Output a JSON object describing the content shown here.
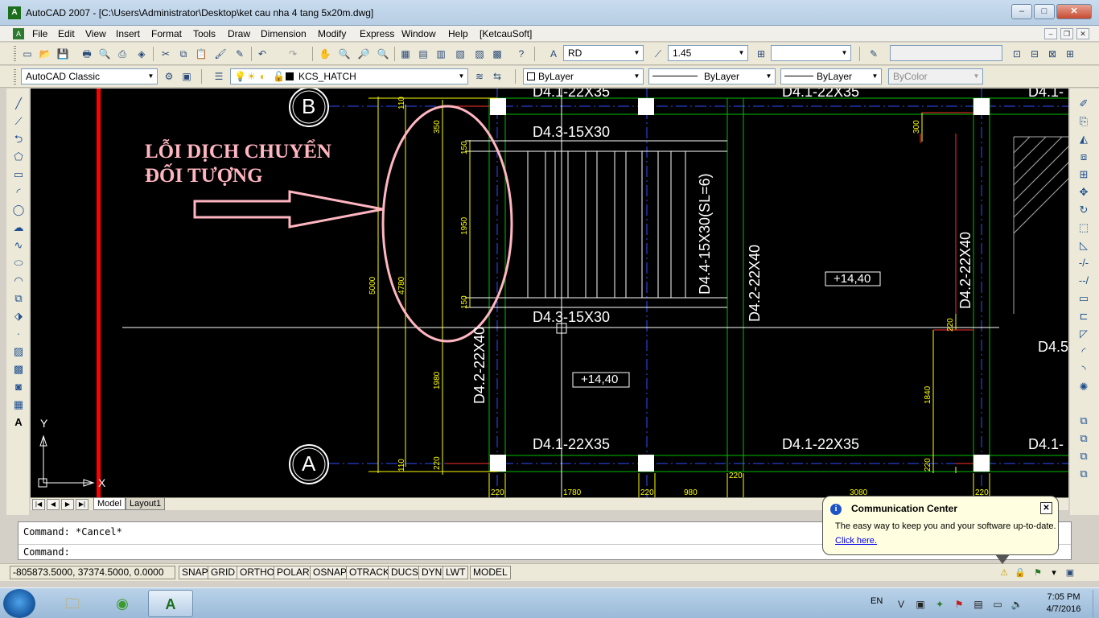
{
  "window": {
    "title": "AutoCAD 2007 - [C:\\Users\\Administrator\\Desktop\\ket cau nha 4 tang 5x20m.dwg]",
    "controls": [
      "–",
      "□",
      "✕"
    ]
  },
  "menubar": {
    "items": [
      "File",
      "Edit",
      "View",
      "Insert",
      "Format",
      "Tools",
      "Draw",
      "Dimension",
      "Modify",
      "Express",
      "Window",
      "Help",
      "[KetcauSoft]"
    ]
  },
  "toolbar": {
    "text_style": "RD",
    "dim_value": "1.45",
    "workspace": "AutoCAD Classic",
    "layer": "KCS_HATCH",
    "color": "ByLayer",
    "linetype": "ByLayer",
    "lineweight": "ByLayer",
    "plotstyle": "ByColor"
  },
  "drawing": {
    "annotation_line1": "LỖI DỊCH CHUYỂN",
    "annotation_line2": "ĐỐI TƯỢNG",
    "grid_b": "B",
    "grid_a": "A",
    "beam_top_left": "D4.1-22X35",
    "beam_top_right": "D4.1-22X35",
    "beam_top_far": "D4.1-",
    "beam_d43_top": "D4.3-15X30",
    "beam_d43_bottom": "D4.3-15X30",
    "beam_d44": "D4.4-15X30(SL=6)",
    "beam_d42_a": "D4.2-22X40",
    "beam_d42_b": "D4.2-22X40",
    "beam_d42_c": "D4.2-22X40",
    "beam_bottom_left": "D4.1-22X35",
    "beam_bottom_right": "D4.1-22X35",
    "beam_bottom_far": "D4.1-",
    "beam_d45": "D4.5",
    "elev_1": "+14,40",
    "elev_2": "+14,40",
    "dims": {
      "d110_top": "110",
      "d350": "350",
      "d150_top": "150",
      "d1950": "1950",
      "d150_bot": "150",
      "d4780": "4780",
      "d5000": "5000",
      "d1980": "1980",
      "d110_bot": "110",
      "d220_bot": "220",
      "d300": "300",
      "d220_r": "220",
      "d1840": "1840",
      "d220_r2": "220",
      "d220_b1": "220",
      "d1780": "1780",
      "d220_b2": "220",
      "d980": "980",
      "d220_b3": "220",
      "d3080": "3080",
      "d220_b4": "220"
    },
    "ucs_y": "Y",
    "ucs_x": "X"
  },
  "tabs": {
    "model": "Model",
    "layout1": "Layout1"
  },
  "command": {
    "line1": "Command: *Cancel*",
    "line2": "Command:"
  },
  "status": {
    "coords": "-805873.5000, 37374.5000, 0.0000",
    "buttons": [
      "SNAP",
      "GRID",
      "ORTHO",
      "POLAR",
      "OSNAP",
      "OTRACK",
      "DUCS",
      "DYN",
      "LWT",
      "MODEL"
    ]
  },
  "balloon": {
    "title": "Communication Center",
    "body": "The easy way to keep you and your software up-to-date.",
    "link": "Click here."
  },
  "taskbar": {
    "lang": "EN",
    "time": "7:05 PM",
    "date": "4/7/2016"
  }
}
